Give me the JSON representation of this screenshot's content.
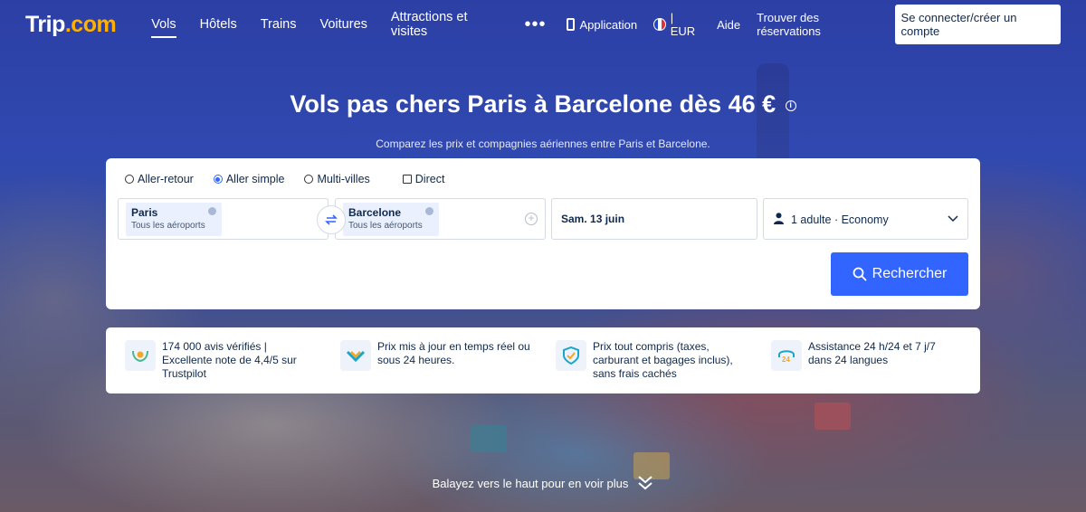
{
  "header": {
    "logo_text": "Trip",
    "logo_suffix": ".com",
    "nav": [
      {
        "label": "Vols",
        "active": true
      },
      {
        "label": "Hôtels"
      },
      {
        "label": "Trains"
      },
      {
        "label": "Voitures"
      },
      {
        "label": "Attractions et visites"
      }
    ],
    "app_label": "Application",
    "currency_label": "| EUR",
    "help_label": "Aide",
    "bookings_label": "Trouver des réservations",
    "login_label": "Se connecter/créer un compte"
  },
  "hero": {
    "title": "Vols pas chers Paris à Barcelone dès 46 €",
    "subtitle": "Comparez les prix et compagnies aériennes entre Paris et Barcelone."
  },
  "search": {
    "trip_types": [
      {
        "label": "Aller-retour",
        "selected": false
      },
      {
        "label": "Aller simple",
        "selected": true
      },
      {
        "label": "Multi-villes",
        "selected": false
      }
    ],
    "direct_label": "Direct",
    "from": {
      "city": "Paris",
      "sub": "Tous les aéroports"
    },
    "to": {
      "city": "Barcelone",
      "sub": "Tous les aéroports"
    },
    "date": "Sam. 13 juin",
    "passengers": "1 adulte · Economy",
    "search_label": "Rechercher",
    "accent_color": "#3264ff"
  },
  "features": [
    {
      "icon": "laurel-icon",
      "text": "174 000 avis vérifiés | Excellente note de 4,4/5 sur Trustpilot"
    },
    {
      "icon": "price-check-icon",
      "text": "Prix mis à jour en temps réel ou sous 24 heures."
    },
    {
      "icon": "shield-check-icon",
      "text": "Prix tout compris (taxes, carburant et bagages inclus), sans frais cachés"
    },
    {
      "icon": "headset-24-icon",
      "text": "Assistance 24 h/24 et 7 j/7 dans 24 langues"
    }
  ],
  "swipe_label": "Balayez vers le haut pour en voir plus"
}
